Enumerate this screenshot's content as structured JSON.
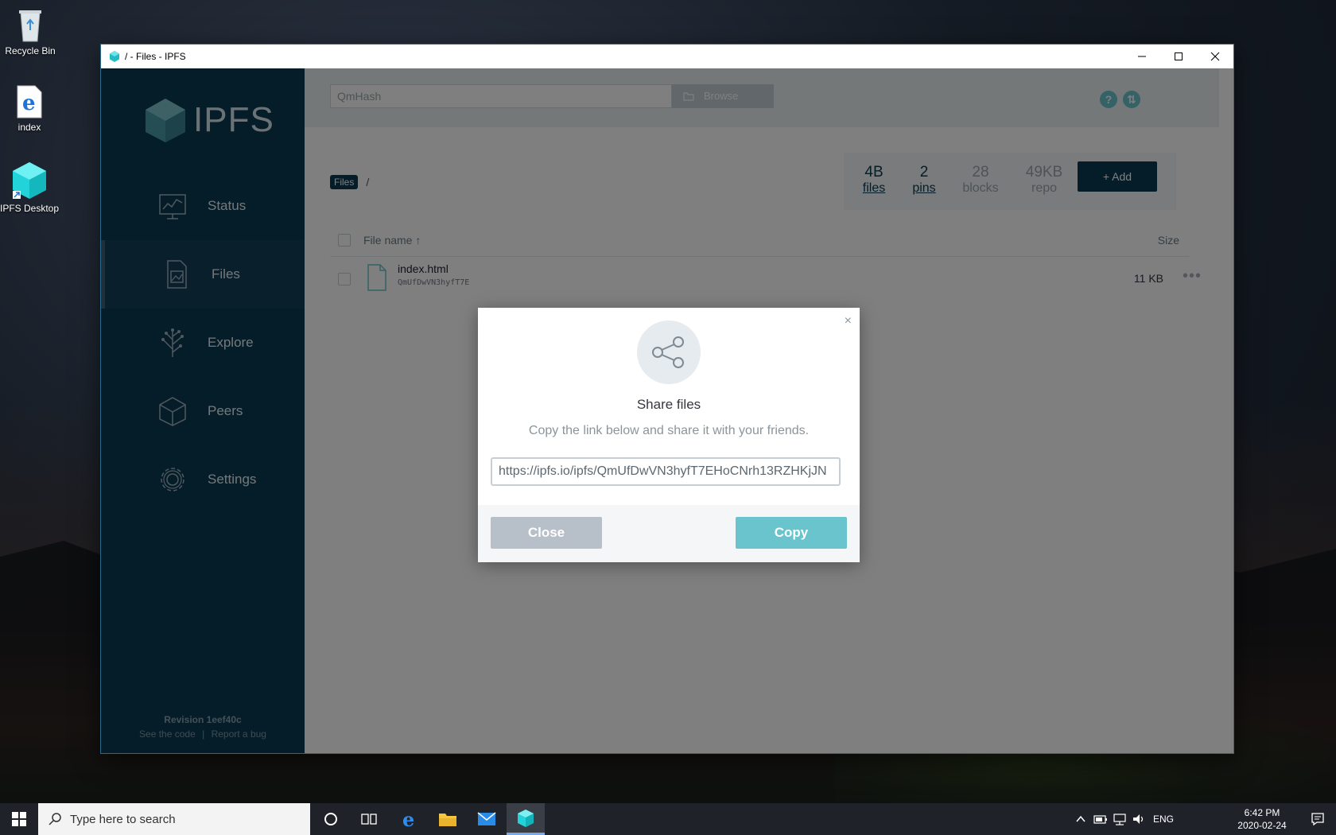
{
  "desktop": {
    "icons": [
      {
        "label": "Recycle Bin"
      },
      {
        "label": "index"
      },
      {
        "label": "IPFS Desktop"
      }
    ]
  },
  "window": {
    "title": "/ - Files - IPFS",
    "controls": {
      "minimize": "minimize-icon",
      "maximize": "maximize-icon",
      "close": "close-icon"
    }
  },
  "sidebar": {
    "logo_text": "IPFS",
    "items": [
      {
        "label": "Status",
        "icon": "status-chart-icon"
      },
      {
        "label": "Files",
        "icon": "files-icon",
        "active": true
      },
      {
        "label": "Explore",
        "icon": "explore-tree-icon"
      },
      {
        "label": "Peers",
        "icon": "peers-cube-icon"
      },
      {
        "label": "Settings",
        "icon": "gear-icon"
      }
    ],
    "footer": {
      "revision": "Revision 1eef40c",
      "see_code": "See the code",
      "separator": "|",
      "report_bug": "Report a bug"
    }
  },
  "header": {
    "search_placeholder": "QmHash",
    "browse_label": "Browse"
  },
  "breadcrumb": {
    "root": "Files",
    "separator": "/"
  },
  "stats": [
    {
      "value": "4B",
      "label": "files"
    },
    {
      "value": "2",
      "label": "pins"
    },
    {
      "value": "28",
      "label": "blocks"
    },
    {
      "value": "49KB",
      "label": "repo"
    }
  ],
  "add_button": "+ Add",
  "table": {
    "columns": {
      "name": "File name ↑",
      "size": "Size"
    },
    "rows": [
      {
        "name": "index.html",
        "hash": "QmUfDwVN3hyfT7E",
        "size": "11 KB",
        "more": "•••"
      }
    ]
  },
  "modal": {
    "close_x": "×",
    "title": "Share files",
    "description": "Copy the link below and share it with your friends.",
    "link": "https://ipfs.io/ipfs/QmUfDwVN3hyfT7EHoCNrh13RZHKjJN",
    "close_label": "Close",
    "copy_label": "Copy"
  },
  "taskbar": {
    "search_placeholder": "Type here to search",
    "tray_lang": "ENG",
    "time": "6:42 PM",
    "date": "2020-02-24"
  },
  "colors": {
    "sidebar": "#0b3a53",
    "accent": "#69c4cd",
    "navy": "#0b3a53"
  }
}
